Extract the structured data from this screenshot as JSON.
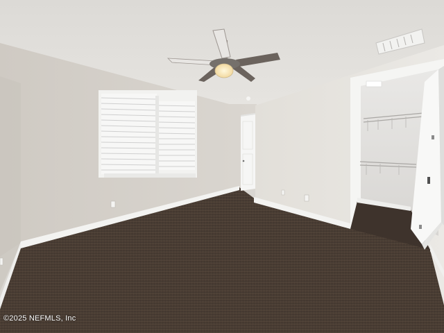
{
  "photo": {
    "subject": "empty bedroom",
    "watermark": "©2025 NEFMLS, Inc"
  },
  "colors": {
    "ceiling": "#e4e2de",
    "wall_left": "#d8d3cc",
    "wall_back": "#dcd8d2",
    "wall_right": "#e3e0da",
    "carpet": "#4a3c32",
    "trim": "#f4f4f2",
    "fan_blade": "#6b635d",
    "light": "#fff2cf"
  }
}
